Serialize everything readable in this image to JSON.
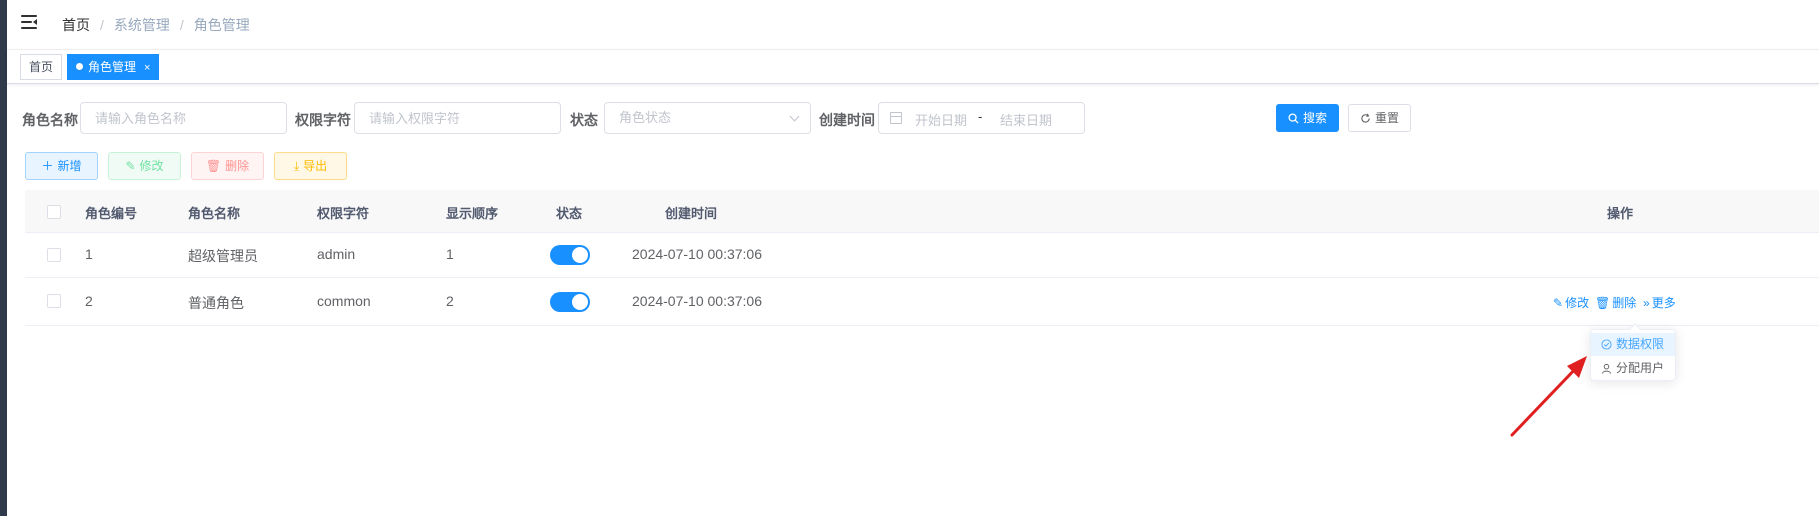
{
  "navbar": {
    "breadcrumb": [
      "首页",
      "系统管理",
      "角色管理"
    ]
  },
  "tags": {
    "home": "首页",
    "active": "角色管理",
    "active_close": "×"
  },
  "search": {
    "role_name_label": "角色名称",
    "role_name_placeholder": "请输入角色名称",
    "perm_label": "权限字符",
    "perm_placeholder": "请输入权限字符",
    "status_label": "状态",
    "status_placeholder": "角色状态",
    "time_label": "创建时间",
    "start_placeholder": "开始日期",
    "range_sep": "-",
    "end_placeholder": "结束日期",
    "search_btn": "搜索",
    "reset_btn": "重置"
  },
  "toolbar": {
    "add": "新增",
    "edit": "修改",
    "delete": "删除",
    "export": "导出"
  },
  "table": {
    "headers": [
      "角色编号",
      "角色名称",
      "权限字符",
      "显示顺序",
      "状态",
      "创建时间",
      "操作"
    ],
    "rows": [
      {
        "id": "1",
        "name": "超级管理员",
        "key": "admin",
        "sort": "1",
        "status": true,
        "created": "2024-07-10 00:37:06"
      },
      {
        "id": "2",
        "name": "普通角色",
        "key": "common",
        "sort": "2",
        "status": true,
        "created": "2024-07-10 00:37:06"
      }
    ],
    "ops": {
      "edit": "修改",
      "delete": "删除",
      "more": "更多"
    }
  },
  "dropdown": {
    "items": [
      "数据权限",
      "分配用户"
    ]
  },
  "colors": {
    "primary": "#1890ff",
    "annotation_arrow": "#e02020"
  }
}
